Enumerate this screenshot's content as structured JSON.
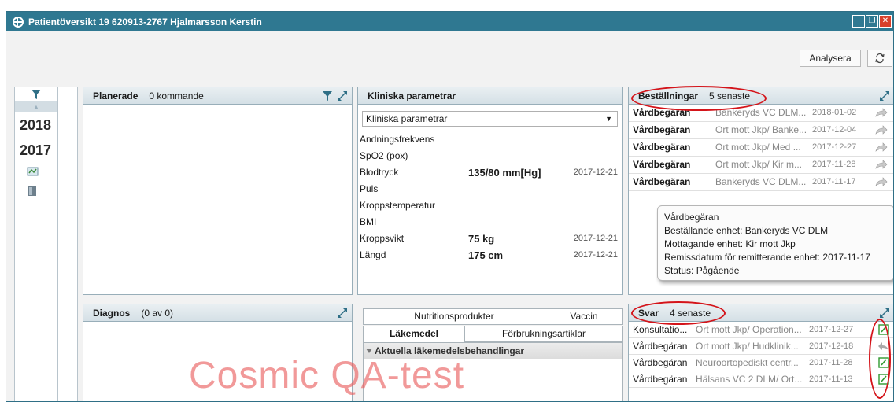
{
  "window": {
    "title": "Patientöversikt 19 620913-2767 Hjalmarsson Kerstin"
  },
  "toolbar": {
    "analyze_label": "Analysera"
  },
  "timeline": {
    "years": [
      "2018",
      "2017"
    ]
  },
  "planerade": {
    "title": "Planerade",
    "subtitle": "0 kommande"
  },
  "kliniska": {
    "title": "Kliniska parametrar",
    "select_value": "Kliniska parametrar",
    "rows": [
      {
        "label": "Andningsfrekvens",
        "value": "",
        "date": ""
      },
      {
        "label": "SpO2 (pox)",
        "value": "",
        "date": ""
      },
      {
        "label": "Blodtryck",
        "value": "135/80 mm[Hg]",
        "date": "2017-12-21"
      },
      {
        "label": "Puls",
        "value": "",
        "date": ""
      },
      {
        "label": "Kroppstemperatur",
        "value": "",
        "date": ""
      },
      {
        "label": "BMI",
        "value": "",
        "date": ""
      },
      {
        "label": "Kroppsvikt",
        "value": "75 kg",
        "date": "2017-12-21"
      },
      {
        "label": "Längd",
        "value": "175 cm",
        "date": "2017-12-21"
      }
    ]
  },
  "bestallningar": {
    "title": "Beställningar",
    "subtitle": "5 senaste",
    "rows": [
      {
        "type": "Vårdbegäran",
        "unit": "Bankeryds VC DLM...",
        "date": "2018-01-02"
      },
      {
        "type": "Vårdbegäran",
        "unit": "Ort mott Jkp/ Banke...",
        "date": "2017-12-04"
      },
      {
        "type": "Vårdbegäran",
        "unit": "Ort mott Jkp/ Med ...",
        "date": "2017-12-27"
      },
      {
        "type": "Vårdbegäran",
        "unit": "Ort mott Jkp/ Kir m...",
        "date": "2017-11-28"
      },
      {
        "type": "Vårdbegäran",
        "unit": "Bankeryds VC DLM...",
        "date": "2017-11-17"
      }
    ],
    "tooltip": {
      "line1": "Vårdbegäran",
      "line2": "Beställande enhet: Bankeryds VC DLM",
      "line3": "Mottagande enhet: Kir mott Jkp",
      "line4": "Remissdatum för remitterande enhet: 2017-11-17",
      "line5": "Status: Pågående"
    }
  },
  "diagnos": {
    "title": "Diagnos",
    "subtitle": "(0 av 0)"
  },
  "lakemedel": {
    "tabs_top": [
      "Nutritionsprodukter",
      "Vaccin"
    ],
    "tabs_bottom": [
      "Läkemedel",
      "Förbrukningsartiklar"
    ],
    "section_title": "Aktuella läkemedelsbehandlingar"
  },
  "svar": {
    "title": "Svar",
    "subtitle": "4 senaste",
    "rows": [
      {
        "type": "Konsultatio...",
        "unit": "Ort mott Jkp/ Operation...",
        "date": "2017-12-27",
        "icon": "edit"
      },
      {
        "type": "Vårdbegäran",
        "unit": "Ort mott Jkp/ Hudklinik...",
        "date": "2017-12-18",
        "icon": "reply"
      },
      {
        "type": "Vårdbegäran",
        "unit": "Neuroortopediskt centr...",
        "date": "2017-11-28",
        "icon": "edit"
      },
      {
        "type": "Vårdbegäran",
        "unit": "Hälsans VC 2 DLM/ Ort...",
        "date": "2017-11-13",
        "icon": "edit"
      }
    ]
  },
  "watermark": "Cosmic QA-test",
  "colors": {
    "titlebar": "#2f7891",
    "annotation": "#d4141a",
    "watermark": "#e85a5a"
  }
}
